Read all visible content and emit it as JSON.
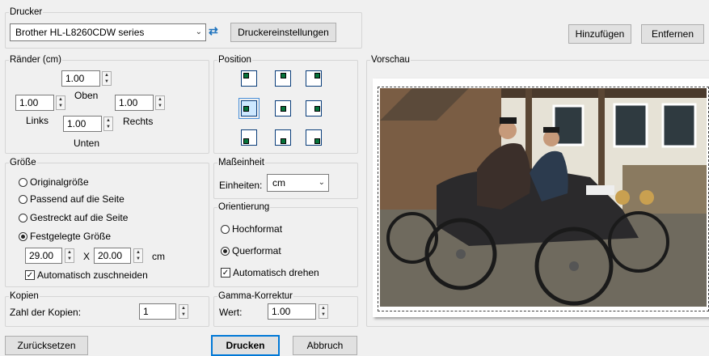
{
  "printer": {
    "legend": "Drucker",
    "selected": "Brother HL-L8260CDW series",
    "settings_label": "Druckereinstellungen"
  },
  "top_buttons": {
    "add": "Hinzufügen",
    "remove": "Entfernen"
  },
  "margins": {
    "legend": "Ränder (cm)",
    "top": "1.00",
    "top_label": "Oben",
    "left": "1.00",
    "left_label": "Links",
    "right": "1.00",
    "right_label": "Rechts",
    "bottom": "1.00",
    "bottom_label": "Unten"
  },
  "position": {
    "legend": "Position",
    "selected": "middle-left"
  },
  "size": {
    "legend": "Größe",
    "options": [
      "Originalgröße",
      "Passend auf die Seite",
      "Gestreckt auf die Seite",
      "Festgelegte Größe"
    ],
    "selected_index": 3,
    "width": "29.00",
    "times": "X",
    "height": "20.00",
    "unit": "cm",
    "auto_crop": "Automatisch zuschneiden"
  },
  "unit": {
    "legend": "Maßeinheit",
    "label": "Einheiten:",
    "value": "cm"
  },
  "orientation": {
    "legend": "Orientierung",
    "portrait": "Hochformat",
    "landscape": "Querformat",
    "selected": "landscape",
    "auto_rotate": "Automatisch drehen"
  },
  "copies": {
    "legend": "Kopien",
    "label": "Zahl der Kopien:",
    "value": "1"
  },
  "gamma": {
    "legend": "Gamma-Korrektur",
    "label": "Wert:",
    "value": "1.00"
  },
  "preview": {
    "legend": "Vorschau"
  },
  "bottom_buttons": {
    "reset": "Zurücksetzen",
    "print": "Drucken",
    "cancel": "Abbruch"
  },
  "colors": {
    "accent": "#0078d7",
    "position_fill": "#06733a"
  }
}
